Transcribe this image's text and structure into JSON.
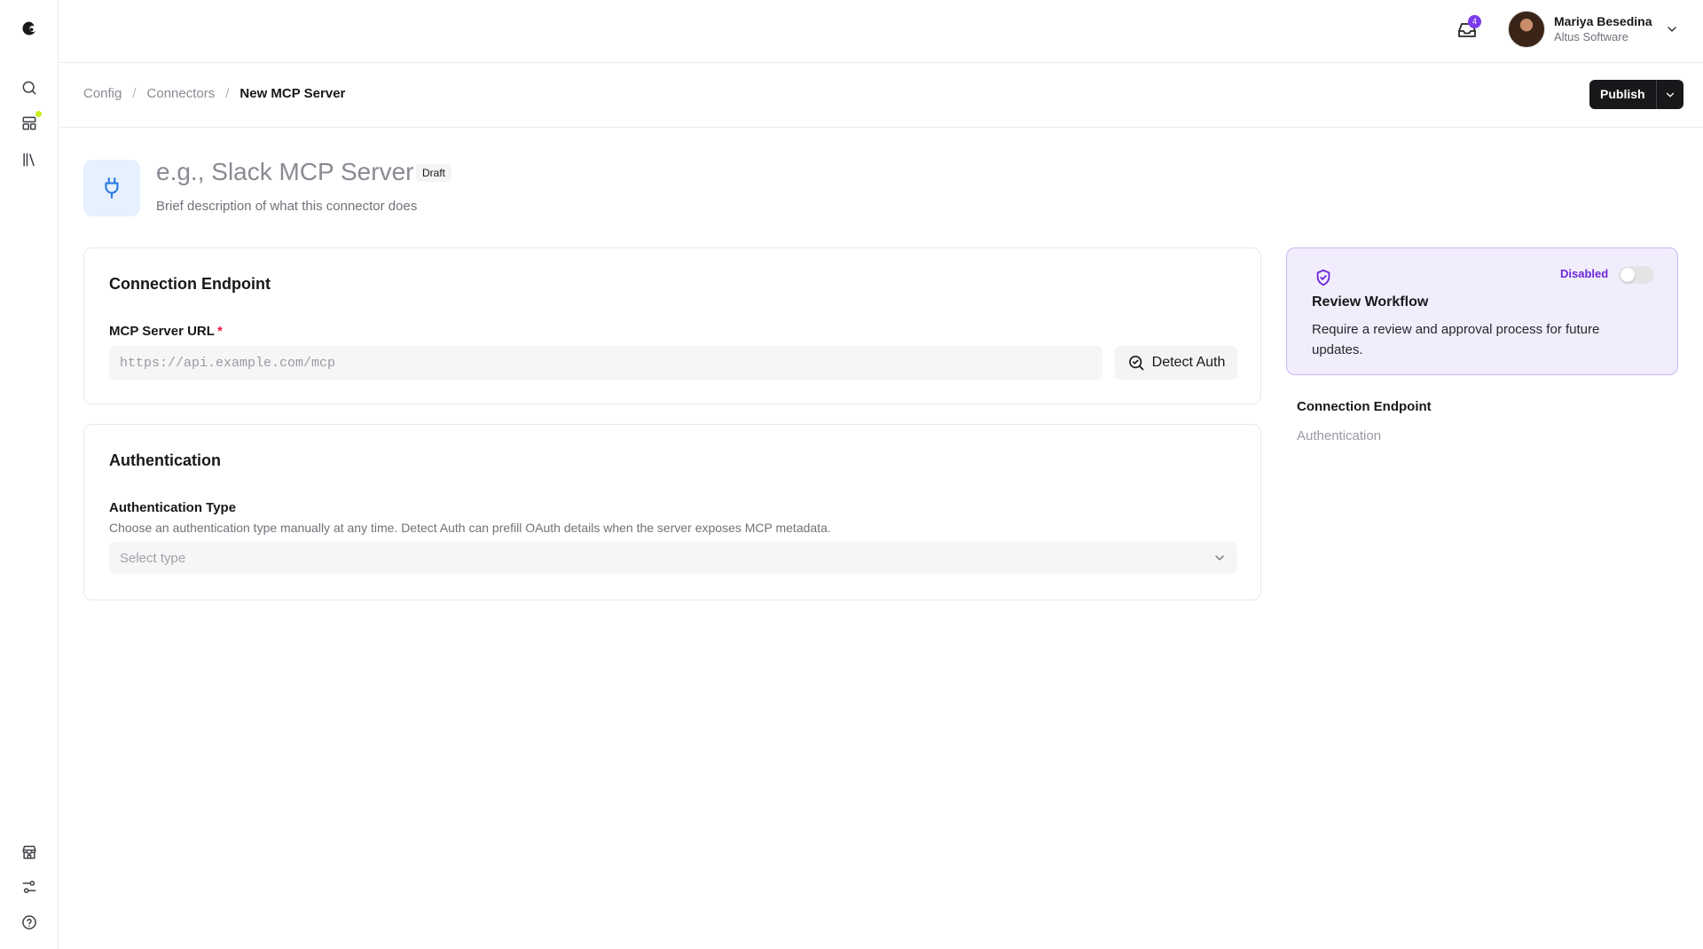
{
  "topbar": {
    "inbox_count": "4",
    "user_name": "Mariya Besedina",
    "user_org": "Altus Software"
  },
  "breadcrumb": {
    "items": [
      "Config",
      "Connectors"
    ],
    "separator": "/",
    "current": "New MCP Server"
  },
  "actions": {
    "publish_label": "Publish"
  },
  "header": {
    "title_placeholder": "e.g., Slack MCP Server",
    "status_badge": "Draft",
    "description_placeholder": "Brief description of what this connector does"
  },
  "connection": {
    "title": "Connection Endpoint",
    "url_label": "MCP Server URL",
    "required_mark": "*",
    "url_placeholder": "https://api.example.com/mcp",
    "url_value": "",
    "detect_label": "Detect Auth"
  },
  "authentication": {
    "title": "Authentication",
    "type_label": "Authentication Type",
    "help": "Choose an authentication type manually at any time. Detect Auth can prefill OAuth details when the server exposes MCP metadata.",
    "select_placeholder": "Select type"
  },
  "review": {
    "status": "Disabled",
    "enabled": false,
    "title": "Review Workflow",
    "description": "Require a review and approval process for future updates."
  },
  "section_nav": {
    "items": [
      "Connection Endpoint",
      "Authentication"
    ],
    "active": "Connection Endpoint"
  },
  "colors": {
    "accent": "#6d28d9",
    "primary_button": "#18181b",
    "plug_icon": "#2f7de1",
    "required": "#e11d48",
    "rail_indicator": "#c6f01e"
  }
}
